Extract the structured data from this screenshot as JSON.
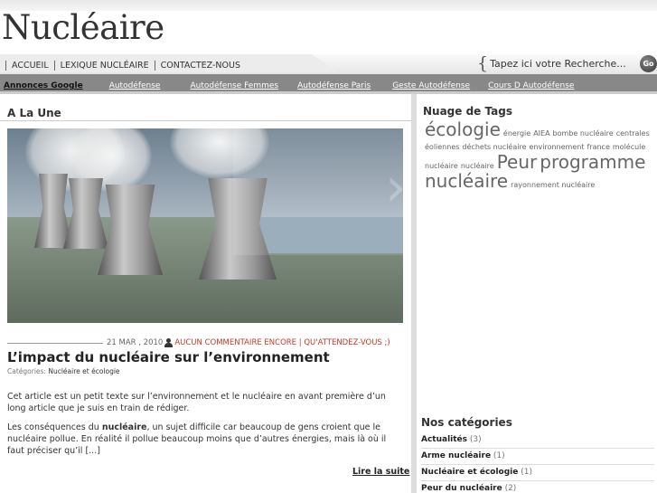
{
  "site": {
    "title": "Nucléaire"
  },
  "nav": {
    "items": [
      "Accueil",
      "Lexique nucléaire",
      "Contactez-nous"
    ]
  },
  "search": {
    "placeholder": "Tapez ici votre Recherche...",
    "go_label": "Go"
  },
  "ads": {
    "label": "Annonces Google",
    "links": [
      "Autodéfense",
      "Autodéfense Femmes",
      "Autodéfense Paris",
      "Geste Autodéfense",
      "Cours D Autodéfense"
    ]
  },
  "main": {
    "heading": "A La Une",
    "post": {
      "date": "21 MAR , 2010",
      "comments": "Aucun commentaire encore | Qu'attendez-vous ;)",
      "title": "L’impact du nucléaire sur l’environnement",
      "categories_label": "Catégories:",
      "categories": "Nucléaire et écologie",
      "para1": "Cet article est un petit texte sur l’environnement et le nucléaire en avant première d’un long article que je suis en train de rédiger.",
      "para2_before": "Les conséquences du ",
      "para2_bold": "nucléaire",
      "para2_after": ", un sujet difficile car beaucoup de gens croient que le nucléaire pollue. En réalité il pollue beaucoup moins que d’autres énergies, mais là où il faut préciser qu’il [...]",
      "read_more": "Lire la suite"
    }
  },
  "sidebar": {
    "tags_heading": "Nuage de Tags",
    "tags": [
      {
        "label": "écologie",
        "size": 20
      },
      {
        "label": "énergie",
        "size": 8
      },
      {
        "label": "AIEA",
        "size": 8
      },
      {
        "label": "bombe nucléaire",
        "size": 8
      },
      {
        "label": "centrales éoliennes",
        "size": 8
      },
      {
        "label": "déchets nucléaire",
        "size": 8
      },
      {
        "label": "environnement",
        "size": 8
      },
      {
        "label": "france",
        "size": 8
      },
      {
        "label": "molécule nucléaire",
        "size": 8
      },
      {
        "label": "nucléaire",
        "size": 8
      },
      {
        "label": "Peur",
        "size": 20
      },
      {
        "label": "programme nucléaire",
        "size": 20
      },
      {
        "label": "rayonnement nucléaire",
        "size": 8
      }
    ],
    "categories_heading": "Nos catégories",
    "categories": [
      {
        "name": "Actualités",
        "count": "(3)"
      },
      {
        "name": "Arme nucléaire",
        "count": "(1)"
      },
      {
        "name": "Nucléaire et écologie",
        "count": "(1)"
      },
      {
        "name": "Peur du nucléaire",
        "count": "(2)"
      }
    ]
  }
}
